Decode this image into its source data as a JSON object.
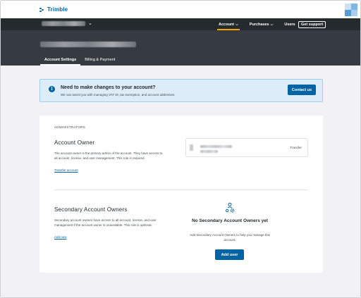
{
  "brand": {
    "logo_text": "Trimble",
    "accent": "#0063a3",
    "nav_highlight": "#f5a400"
  },
  "nav": {
    "items": [
      {
        "label": "Account",
        "active": true,
        "has_dropdown": true
      },
      {
        "label": "Purchases",
        "active": false,
        "has_dropdown": true
      },
      {
        "label": "Users",
        "active": false,
        "has_dropdown": false
      }
    ],
    "support_label": "Get support"
  },
  "tabs": [
    {
      "label": "Account Settings",
      "active": true
    },
    {
      "label": "Billing & Payment",
      "active": false
    }
  ],
  "banner": {
    "title": "Need to make changes to your account?",
    "subtitle": "We can assist you with managing VAT ID, tax exemption, and account addresses.",
    "button": "Contact us",
    "icon": "info-icon"
  },
  "administrators": {
    "section_label": "ADMINISTRATORS",
    "owner": {
      "heading": "Account Owner",
      "description": "The account owner is the primary admin of the account. They have access to all account, license, and user management. This role is required.",
      "link": "Transfer account",
      "card_action": "Transfer"
    },
    "secondary": {
      "heading": "Secondary Account Owners",
      "description": "Secondary account owners have access to all account, license, and user management if the account owner is unavailable. This role is optional.",
      "link": "Add new",
      "empty_title": "No Secondary Account Owners yet",
      "empty_subtitle": "Add Secondary Account Owners to help you manage this account.",
      "button": "Add user",
      "icon": "users-settings-icon"
    }
  }
}
